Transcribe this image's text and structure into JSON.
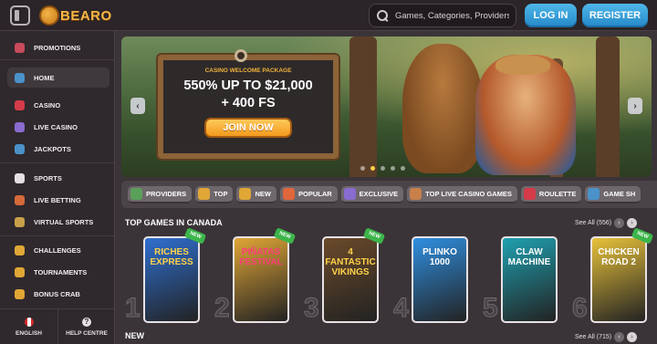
{
  "header": {
    "logo_text": "BEARO",
    "search_placeholder": "Games, Categories, Providers",
    "login_label": "LOG IN",
    "register_label": "REGISTER",
    "accent": "#2b8fd0"
  },
  "sidebar": {
    "items": [
      {
        "label": "PROMOTIONS",
        "icon": "gift-icon",
        "color": "#c94a5a"
      },
      {
        "label": "HOME",
        "icon": "home-icon",
        "color": "#4a92c9",
        "active": true
      },
      {
        "label": "CASINO",
        "icon": "cherry-icon",
        "color": "#d63b4a"
      },
      {
        "label": "LIVE CASINO",
        "icon": "cards-icon",
        "color": "#8a6bd0"
      },
      {
        "label": "JACKPOTS",
        "icon": "horseshoe-icon",
        "color": "#4a92c9"
      },
      {
        "label": "SPORTS",
        "icon": "soccer-ball-icon",
        "color": "#e5e0e3"
      },
      {
        "label": "LIVE BETTING",
        "icon": "live-icon",
        "color": "#d66a3b"
      },
      {
        "label": "VIRTUAL SPORTS",
        "icon": "horse-icon",
        "color": "#c9a04a"
      },
      {
        "label": "CHALLENGES",
        "icon": "medal-icon",
        "color": "#e0a636"
      },
      {
        "label": "TOURNAMENTS",
        "icon": "trophy-icon",
        "color": "#e0a636"
      },
      {
        "label": "BONUS CRAB",
        "icon": "crab-icon",
        "color": "#e0a636"
      }
    ],
    "footer": {
      "language_label": "ENGLISH",
      "help_label": "HELP CENTRE"
    }
  },
  "banner": {
    "subtitle": "CASINO WELCOME PACKAGE",
    "headline_line1": "550% UP TO $21,000",
    "headline_line2": "+ 400 FS",
    "cta_label": "JOIN NOW",
    "prev_label": "‹",
    "next_label": "›",
    "slide_count": 5,
    "active_slide": 1
  },
  "categories": [
    {
      "label": "PROVIDERS",
      "icon": "providers-icon",
      "color": "#5aa05a"
    },
    {
      "label": "TOP",
      "icon": "star-icon",
      "color": "#e0a636"
    },
    {
      "label": "NEW",
      "icon": "lightning-icon",
      "color": "#e0a636"
    },
    {
      "label": "POPULAR",
      "icon": "fire-icon",
      "color": "#e0663b"
    },
    {
      "label": "EXCLUSIVE",
      "icon": "diamond-icon",
      "color": "#8a6bd0"
    },
    {
      "label": "TOP LIVE CASINO GAMES",
      "icon": "live-dealer-icon",
      "color": "#c9804a"
    },
    {
      "label": "ROULETTE",
      "icon": "roulette-icon",
      "color": "#d63b4a"
    },
    {
      "label": "GAME SH",
      "icon": "game-show-icon",
      "color": "#4a92c9"
    }
  ],
  "top_games": {
    "title": "TOP GAMES IN CANADA",
    "see_all_label": "See All (556)",
    "prev_label": "‹",
    "next_label": "›",
    "games": [
      {
        "rank": "1",
        "title": "RICHES EXPRESS",
        "new": true,
        "bg": "#2f6fd0",
        "fg": "#ffd34a"
      },
      {
        "rank": "2",
        "title": "PIÑATAS FESTIVAL",
        "new": true,
        "bg": "#e0a636",
        "fg": "#ff3d7a"
      },
      {
        "rank": "3",
        "title": "4 FANTASTIC VIKINGS",
        "new": true,
        "bg": "#6b4a2a",
        "fg": "#ffd34a"
      },
      {
        "rank": "4",
        "title": "PLINKO 1000",
        "new": false,
        "bg": "#2f8fe0",
        "fg": "#ffffff"
      },
      {
        "rank": "5",
        "title": "CLAW MACHINE",
        "new": false,
        "bg": "#1fa0b0",
        "fg": "#ffffff"
      },
      {
        "rank": "6",
        "title": "CHICKEN ROAD 2",
        "new": true,
        "bg": "#e8c23a",
        "fg": "#ffffff"
      }
    ]
  },
  "new_games": {
    "title": "NEW",
    "see_all_label": "See All (715)",
    "prev_label": "‹",
    "next_label": "›"
  }
}
